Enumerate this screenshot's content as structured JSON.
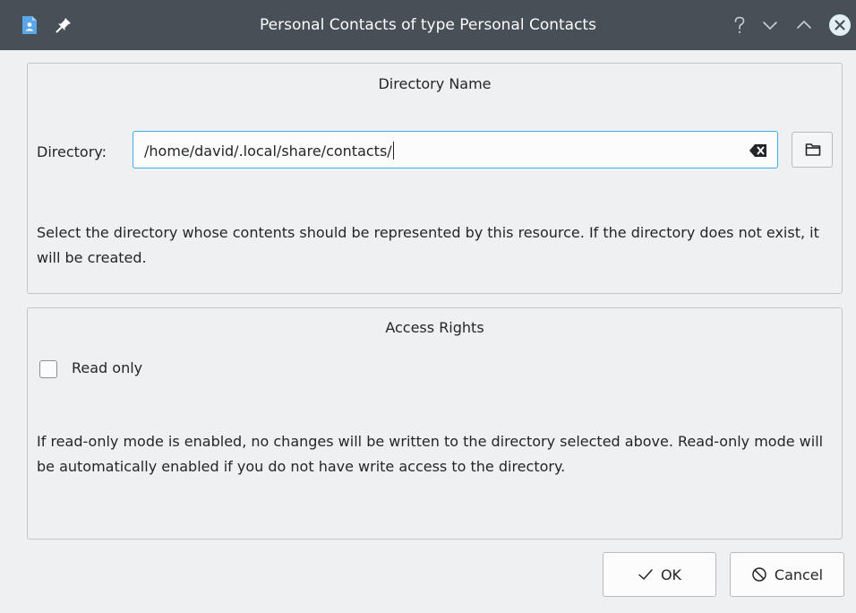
{
  "window": {
    "title": "Personal Contacts of type Personal Contacts",
    "app_icon": "contacts-app-icon",
    "title_buttons": [
      "help-icon",
      "minimize-icon",
      "maximize-icon",
      "close-icon"
    ]
  },
  "directory_group": {
    "title": "Directory Name",
    "label": "Directory:",
    "value": "/home/david/.local/share/contacts/",
    "description": "Select the directory whose contents should be represented by this resource. If the directory does not exist, it will be created."
  },
  "access_group": {
    "title": "Access Rights",
    "read_only": {
      "label": "Read only",
      "checked": false
    },
    "description": "If read-only mode is enabled, no changes will be written to the directory selected above. Read-only mode will be automatically enabled if you do not have write access to the directory."
  },
  "buttons": {
    "ok": "OK",
    "cancel": "Cancel"
  },
  "colors": {
    "titlebar": "#475057",
    "close_button": "#e4eef5",
    "focus": "#3daee9",
    "window_bg": "#eff0f1"
  }
}
